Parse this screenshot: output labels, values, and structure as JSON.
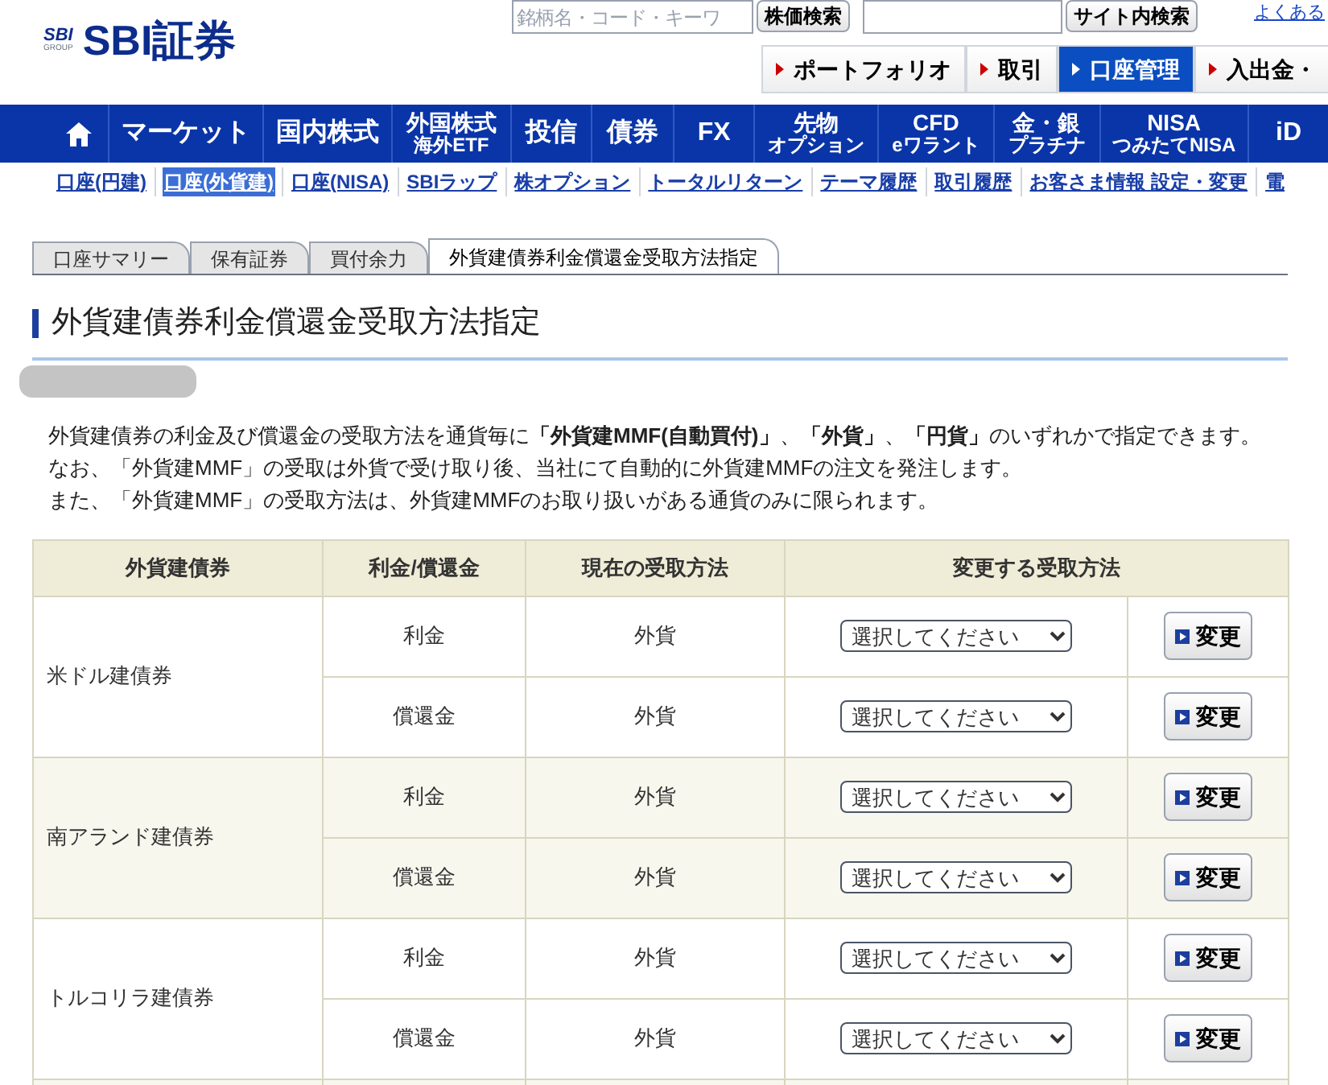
{
  "header": {
    "logo_mark": "SBI",
    "logo_sub": "GROUP",
    "logo_text": "SBI証券",
    "stock_search": {
      "placeholder": "銘柄名・コード・キーワ",
      "button": "株価検索"
    },
    "site_search": {
      "button": "サイト内検索"
    },
    "help_link": "よくある"
  },
  "main_tabs": [
    {
      "label": "ポートフォリオ",
      "selected": false
    },
    {
      "label": "取引",
      "selected": false
    },
    {
      "label": "口座管理",
      "selected": true
    },
    {
      "label": "入出金・",
      "selected": false
    }
  ],
  "nav": [
    {
      "kind": "home"
    },
    {
      "kind": "text",
      "lines": [
        "マーケット"
      ]
    },
    {
      "kind": "text",
      "lines": [
        "国内株式"
      ]
    },
    {
      "kind": "text",
      "lines": [
        "外国株式",
        "海外ETF"
      ]
    },
    {
      "kind": "text",
      "lines": [
        "投信"
      ]
    },
    {
      "kind": "text",
      "lines": [
        "債券"
      ]
    },
    {
      "kind": "text",
      "lines": [
        "FX"
      ]
    },
    {
      "kind": "text",
      "lines": [
        "先物",
        "オプション"
      ]
    },
    {
      "kind": "text",
      "lines": [
        "CFD",
        "eワラント"
      ]
    },
    {
      "kind": "text",
      "lines": [
        "金・銀",
        "プラチナ"
      ]
    },
    {
      "kind": "text",
      "lines": [
        "NISA",
        "つみたてNISA"
      ]
    },
    {
      "kind": "text",
      "lines": [
        "iD"
      ]
    }
  ],
  "sub_nav": [
    {
      "label": "口座(円建)",
      "selected": false
    },
    {
      "label": "口座(外貨建)",
      "selected": true
    },
    {
      "label": "口座(NISA)",
      "selected": false
    },
    {
      "label": "SBIラップ",
      "selected": false
    },
    {
      "label": "株オプション",
      "selected": false
    },
    {
      "label": "トータルリターン",
      "selected": false
    },
    {
      "label": "テーマ履歴",
      "selected": false
    },
    {
      "label": "取引履歴",
      "selected": false
    },
    {
      "label": "お客さま情報 設定・変更",
      "selected": false
    },
    {
      "label": "電",
      "selected": false
    }
  ],
  "page_tabs": [
    {
      "label": "口座サマリー",
      "selected": false
    },
    {
      "label": "保有証券",
      "selected": false
    },
    {
      "label": "買付余力",
      "selected": false
    },
    {
      "label": "外貨建債券利金償還金受取方法指定",
      "selected": true
    }
  ],
  "title": "外貨建債券利金償還金受取方法指定",
  "description": [
    "外貨建債券の利金及び償還金の受取方法を通貨毎に**「外貨建MMF(自動買付)」**、**「外貨」**、**「円貨」**のいずれかで指定できます。",
    "なお、「外貨建MMF」の受取は外貨で受け取り後、当社にて自動的に外貨建MMFの注文を発注します。",
    "また、「外貨建MMF」の受取方法は、外貨建MMFのお取り扱いがある通貨のみに限られます。"
  ],
  "table": {
    "columns": [
      "外貨建債券",
      "利金/償還金",
      "現在の受取方法",
      "変更する受取方法"
    ],
    "rows": [
      {
        "bond": "米ドル建債券",
        "items": [
          {
            "type": "利金",
            "current": "外貨",
            "select": "選択してください",
            "button": "変更"
          },
          {
            "type": "償還金",
            "current": "外貨",
            "select": "選択してください",
            "button": "変更"
          }
        ]
      },
      {
        "bond": "南アランド建債券",
        "items": [
          {
            "type": "利金",
            "current": "外貨",
            "select": "選択してください",
            "button": "変更"
          },
          {
            "type": "償還金",
            "current": "外貨",
            "select": "選択してください",
            "button": "変更"
          }
        ]
      },
      {
        "bond": "トルコリラ建債券",
        "items": [
          {
            "type": "利金",
            "current": "外貨",
            "select": "選択してください",
            "button": "変更"
          },
          {
            "type": "償還金",
            "current": "外貨",
            "select": "選択してください",
            "button": "変更"
          }
        ]
      }
    ]
  }
}
